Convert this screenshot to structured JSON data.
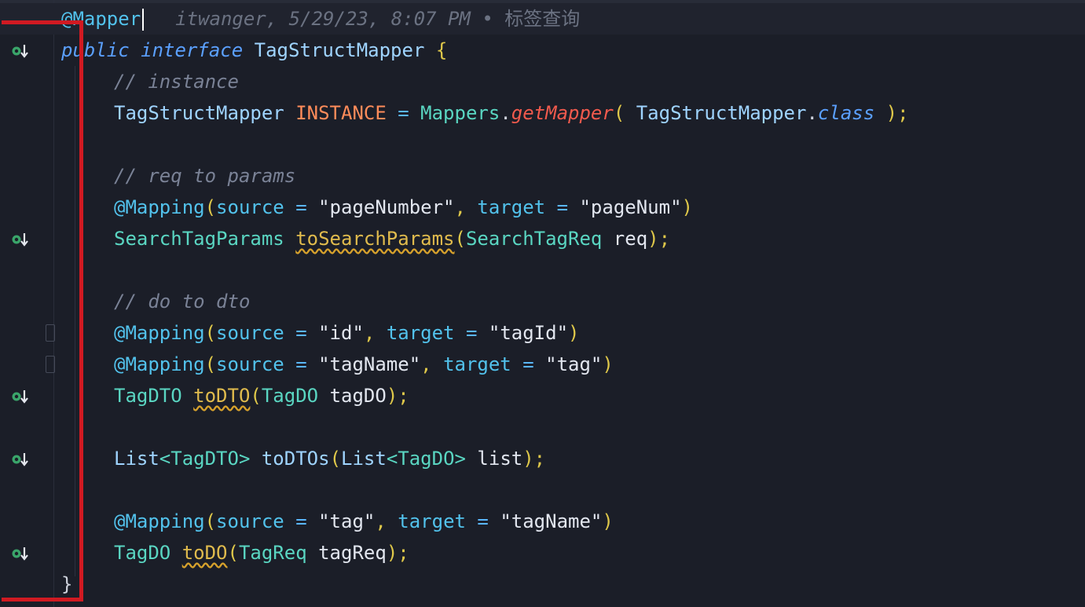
{
  "editor": {
    "file_class": "TagStructMapper",
    "blame": {
      "author": "itwanger,",
      "date": "5/29/23,",
      "time": "8:07 PM",
      "separator": "•",
      "message": "标签查询"
    },
    "colors": {
      "background": "#1b1e28",
      "highlight": "#d11a22",
      "annotation": "#52c2ec",
      "keyword": "#5ba0ff",
      "class": "#5ad6c2",
      "string": "#e2e6ef",
      "comment": "#7a8296",
      "constant": "#ff8c5a",
      "warning": "#e0bb4d"
    },
    "gutter_icon": "implemented-down-icon",
    "lines": {
      "l1": {
        "annotation": "@Mapper"
      },
      "l2": {
        "kw1": "public",
        "kw2": "interface",
        "name": "TagStructMapper",
        "brace": "{"
      },
      "l3": {
        "comment": "// instance"
      },
      "l4": {
        "type": "TagStructMapper",
        "const": "INSTANCE",
        "eq": "=",
        "mappers": "Mappers",
        "dot": ".",
        "method": "getMapper",
        "open": "(",
        "arg": "TagStructMapper",
        "dot2": ".",
        "cls_kw": "class",
        "close": ");"
      },
      "l6": {
        "comment": "// req to params"
      },
      "l7": {
        "ann": "@Mapping",
        "open": "(",
        "k1": "source",
        "eq1": "=",
        "v1": "\"pageNumber\"",
        "comma": ",",
        "k2": "target",
        "eq2": "=",
        "v2": "\"pageNum\"",
        "close": ")"
      },
      "l8": {
        "type": "SearchTagParams",
        "method": "toSearchParams",
        "open": "(",
        "ptype": "SearchTagReq",
        "pname": "req",
        "close": ");"
      },
      "l10": {
        "comment": "// do to dto"
      },
      "l11": {
        "ann": "@Mapping",
        "open": "(",
        "k1": "source",
        "eq1": "=",
        "v1": "\"id\"",
        "comma": ",",
        "k2": "target",
        "eq2": "=",
        "v2": "\"tagId\"",
        "close": ")"
      },
      "l12": {
        "ann": "@Mapping",
        "open": "(",
        "k1": "source",
        "eq1": "=",
        "v1": "\"tagName\"",
        "comma": ",",
        "k2": "target",
        "eq2": "=",
        "v2": "\"tag\"",
        "close": ")"
      },
      "l13": {
        "type": "TagDTO",
        "method": "toDTO",
        "open": "(",
        "ptype": "TagDO",
        "pname": "tagDO",
        "close": ");"
      },
      "l15": {
        "list1": "List",
        "lt1": "<",
        "g1": "TagDTO",
        "gt1": ">",
        "method": "toDTOs",
        "open": "(",
        "list2": "List",
        "lt2": "<",
        "g2": "TagDO",
        "gt2": ">",
        "pname": "list",
        "close": ");"
      },
      "l17": {
        "ann": "@Mapping",
        "open": "(",
        "k1": "source",
        "eq1": "=",
        "v1": "\"tag\"",
        "comma": ",",
        "k2": "target",
        "eq2": "=",
        "v2": "\"tagName\"",
        "close": ")"
      },
      "l18": {
        "type": "TagDO",
        "method": "toDO",
        "open": "(",
        "ptype": "TagReq",
        "pname": "tagReq",
        "close": ");"
      },
      "l19": {
        "brace": "}"
      }
    }
  }
}
